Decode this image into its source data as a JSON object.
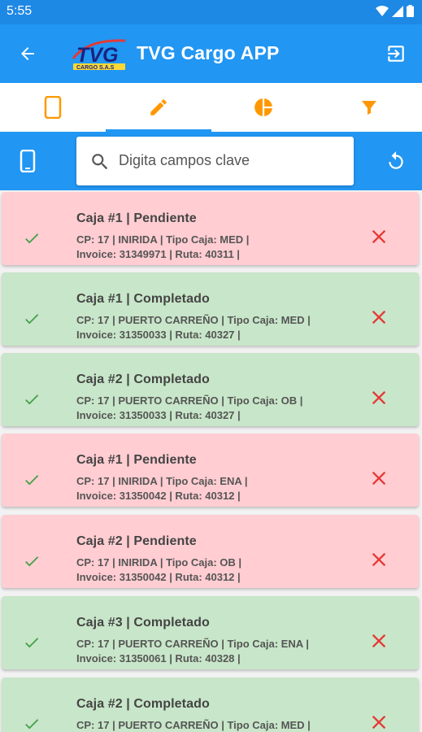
{
  "status_bar": {
    "time": "5:55"
  },
  "app_bar": {
    "title": "TVG Cargo APP",
    "logo_text": "TVG",
    "logo_subtext": "CARGO S.A.S"
  },
  "tabs": [
    {
      "icon": "phone-icon",
      "color": "#ff9800",
      "active": false
    },
    {
      "icon": "edit-icon",
      "color": "#ff9800",
      "active": true
    },
    {
      "icon": "pie-chart-icon",
      "color": "#ff9800",
      "active": false
    },
    {
      "icon": "filter-icon",
      "color": "#ff9800",
      "active": false
    }
  ],
  "search": {
    "placeholder": "Digita campos clave",
    "value": ""
  },
  "colors": {
    "primary": "#2196f3",
    "accent": "#ff9800",
    "pending_bg": "#ffcdd2",
    "completed_bg": "#c8e6c9",
    "check": "#43a047",
    "delete": "#e53935"
  },
  "cards": [
    {
      "title": "Caja #1 | Pendiente",
      "line1": "CP: 17 | INIRIDA | Tipo Caja: MED |",
      "line2": "Invoice: 31349971 | Ruta: 40311 |",
      "status": "pendiente"
    },
    {
      "title": "Caja #1 | Completado",
      "line1": "CP: 17 | PUERTO CARREÑO | Tipo Caja: MED |",
      "line2": "Invoice: 31350033 | Ruta: 40327 |",
      "status": "completado"
    },
    {
      "title": "Caja #2 | Completado",
      "line1": "CP: 17 | PUERTO CARREÑO | Tipo Caja: OB |",
      "line2": "Invoice: 31350033 | Ruta: 40327 |",
      "status": "completado"
    },
    {
      "title": "Caja #1 | Pendiente",
      "line1": "CP: 17 | INIRIDA | Tipo Caja: ENA |",
      "line2": "Invoice: 31350042 | Ruta: 40312 |",
      "status": "pendiente"
    },
    {
      "title": "Caja #2 | Pendiente",
      "line1": "CP: 17 | INIRIDA | Tipo Caja: OB |",
      "line2": "Invoice: 31350042 | Ruta: 40312 |",
      "status": "pendiente"
    },
    {
      "title": "Caja #3 | Completado",
      "line1": "CP: 17 | PUERTO CARREÑO | Tipo Caja: ENA |",
      "line2": "Invoice: 31350061 | Ruta: 40328 |",
      "status": "completado"
    },
    {
      "title": "Caja #2 | Completado",
      "line1": "CP: 17 | PUERTO CARREÑO | Tipo Caja: MED |",
      "line2": "",
      "status": "completado"
    }
  ]
}
